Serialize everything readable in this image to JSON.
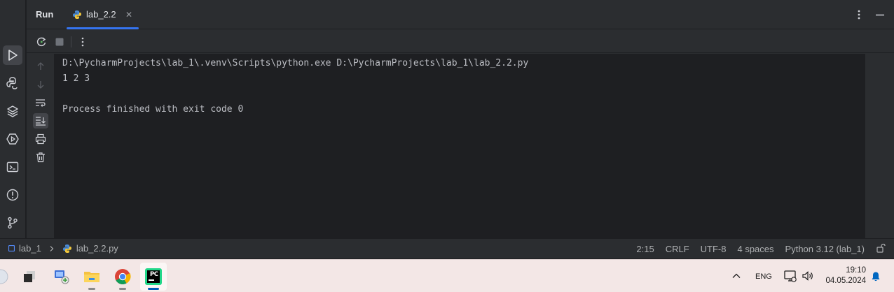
{
  "run_panel": {
    "title": "Run",
    "tab": {
      "label": "lab_2.2",
      "close_glyph": "✕",
      "icon": "python-icon"
    }
  },
  "console": {
    "lines": [
      "D:\\PycharmProjects\\lab_1\\.venv\\Scripts\\python.exe D:\\PycharmProjects\\lab_1\\lab_2.2.py",
      "1 2 3",
      "",
      "Process finished with exit code 0"
    ]
  },
  "status_bar": {
    "breadcrumb": {
      "project": "lab_1",
      "file": "lab_2.2.py"
    },
    "position": "2:15",
    "line_separator": "CRLF",
    "encoding": "UTF-8",
    "indent": "4 spaces",
    "interpreter": "Python 3.12 (lab_1)"
  },
  "taskbar": {
    "apps": [
      "windows-start",
      "task-view",
      "explorer-app",
      "file-explorer",
      "chrome",
      "pycharm"
    ],
    "active_app": "pycharm",
    "language": "ENG",
    "time": "19:10",
    "date": "04.05.2024",
    "pycharm_label": "PC"
  },
  "colors": {
    "accent": "#3574f0",
    "console_bg": "#1e1f22",
    "panel_bg": "#2b2d30",
    "taskbar_bg": "#f3e7e6"
  }
}
